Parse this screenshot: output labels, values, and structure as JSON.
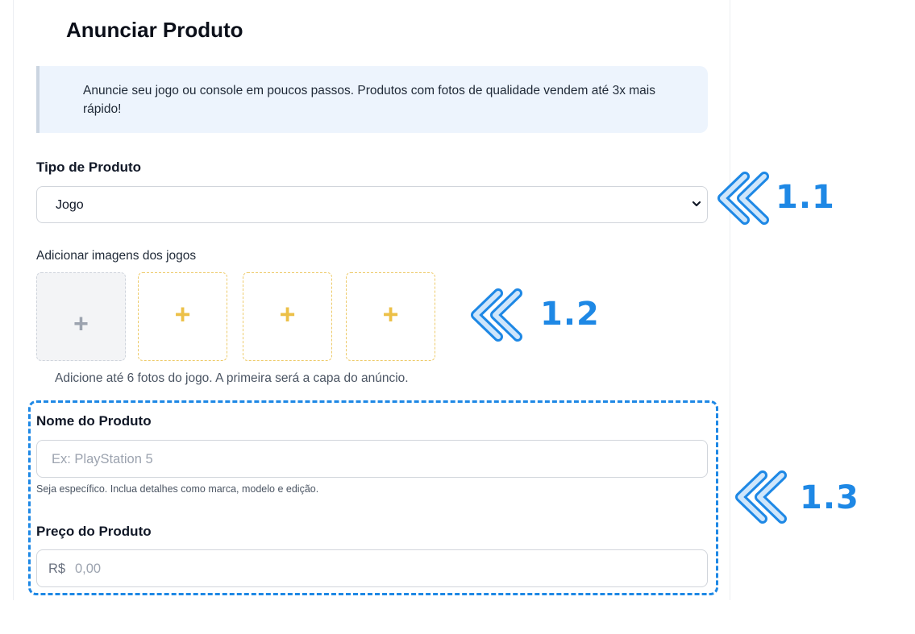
{
  "page": {
    "title": "Anunciar Produto",
    "info": "Anuncie seu jogo ou console em poucos passos. Produtos com fotos de qualidade vendem até 3x mais rápido!"
  },
  "product_type": {
    "label": "Tipo de Produto",
    "selected": "Jogo",
    "icon": "chevron-down-icon"
  },
  "images": {
    "label": "Adicionar imagens dos jogos",
    "slots": [
      "+",
      "+",
      "+",
      "+"
    ],
    "helper": "Adicione até 6 fotos do jogo. A primeira será a capa do anúncio."
  },
  "name_field": {
    "label": "Nome do Produto",
    "placeholder": "Ex: PlayStation 5",
    "helper": "Seja específico. Inclua detalhes como marca, modelo e edição."
  },
  "price_field": {
    "label": "Preço do Produto",
    "prefix": "R$",
    "placeholder": "0,00"
  },
  "annotations": [
    "1.1",
    "1.2",
    "1.3"
  ],
  "colors": {
    "accent": "#1e88e5",
    "info_bg": "#edf4fd",
    "add_slot_plus": "#ecc048",
    "primary_slot_plus": "#9ca3af"
  }
}
